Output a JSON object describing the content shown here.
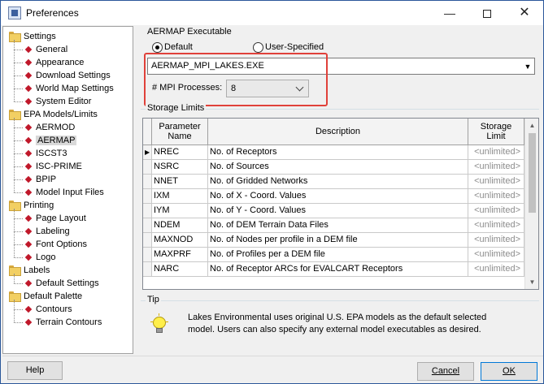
{
  "window": {
    "title": "Preferences"
  },
  "tree": {
    "groups": [
      {
        "label": "Settings",
        "items": [
          "General",
          "Appearance",
          "Download Settings",
          "World Map Settings",
          "System Editor"
        ]
      },
      {
        "label": "EPA Models/Limits",
        "items": [
          "AERMOD",
          "AERMAP",
          "ISCST3",
          "ISC-PRIME",
          "BPIP",
          "Model Input Files"
        ]
      },
      {
        "label": "Printing",
        "items": [
          "Page Layout",
          "Labeling",
          "Font Options",
          "Logo"
        ]
      },
      {
        "label": "Labels",
        "items": [
          "Default Settings"
        ]
      },
      {
        "label": "Default Palette",
        "items": [
          "Contours",
          "Terrain Contours"
        ]
      }
    ],
    "selected": "AERMAP"
  },
  "executable": {
    "legend": "AERMAP Executable",
    "default_label": "Default",
    "user_label": "User-Specified",
    "selected_option": "Default",
    "exe_value": "AERMAP_MPI_LAKES.EXE",
    "mpi_label": "# MPI Processes:",
    "mpi_value": "8"
  },
  "storage": {
    "legend": "Storage Limits",
    "columns": [
      "Parameter Name",
      "Description",
      "Storage Limit"
    ],
    "rows": [
      {
        "name": "NREC",
        "desc": "No. of Receptors",
        "limit": "<unlimited>"
      },
      {
        "name": "NSRC",
        "desc": "No. of Sources",
        "limit": "<unlimited>"
      },
      {
        "name": "NNET",
        "desc": "No. of Gridded Networks",
        "limit": "<unlimited>"
      },
      {
        "name": "IXM",
        "desc": "No. of X - Coord. Values",
        "limit": "<unlimited>"
      },
      {
        "name": "IYM",
        "desc": "No. of Y - Coord. Values",
        "limit": "<unlimited>"
      },
      {
        "name": "NDEM",
        "desc": "No. of DEM Terrain Data Files",
        "limit": "<unlimited>"
      },
      {
        "name": "MAXNOD",
        "desc": "No. of Nodes per profile in a DEM file",
        "limit": "<unlimited>"
      },
      {
        "name": "MAXPRF",
        "desc": "No. of Profiles per a DEM file",
        "limit": "<unlimited>"
      },
      {
        "name": "NARC",
        "desc": "No. of Receptor ARCs for EVALCART Receptors",
        "limit": "<unlimited>"
      }
    ]
  },
  "tip": {
    "legend": "Tip",
    "text_line1": "Lakes Environmental uses original U.S. EPA models as the default selected",
    "text_line2": "model.  Users can also specify any external model executables as desired."
  },
  "buttons": {
    "help": "Help",
    "cancel": "Cancel",
    "ok": "OK"
  },
  "colors": {
    "highlight": "#e0413a",
    "accent": "#0078d7",
    "bullet": "#c0182a"
  }
}
